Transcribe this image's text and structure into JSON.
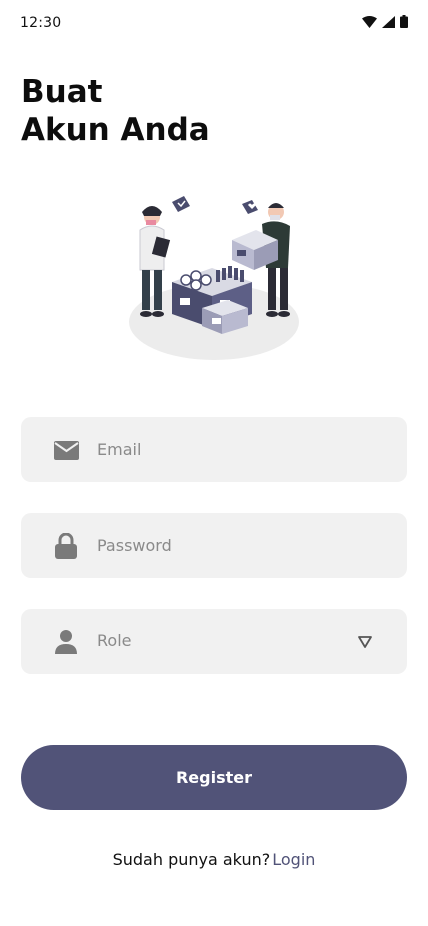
{
  "status_bar": {
    "time": "12:30",
    "icons": [
      "wifi-icon",
      "signal-icon",
      "battery-icon"
    ]
  },
  "title": {
    "line1": "Buat",
    "line2": "Akun Anda"
  },
  "form": {
    "email": {
      "placeholder": "Email",
      "icon": "mail-icon"
    },
    "password": {
      "placeholder": "Password",
      "icon": "lock-icon"
    },
    "role": {
      "placeholder": "Role",
      "icon": "person-icon",
      "caret": "triangle-down-icon"
    }
  },
  "register_label": "Register",
  "footer": {
    "prompt": "Sudah punya akun?",
    "login_link": "Login"
  },
  "colors": {
    "primary": "#515378",
    "field_bg": "#f1f1f1",
    "icon": "#7a7a7a",
    "placeholder": "#8a8a8a"
  }
}
